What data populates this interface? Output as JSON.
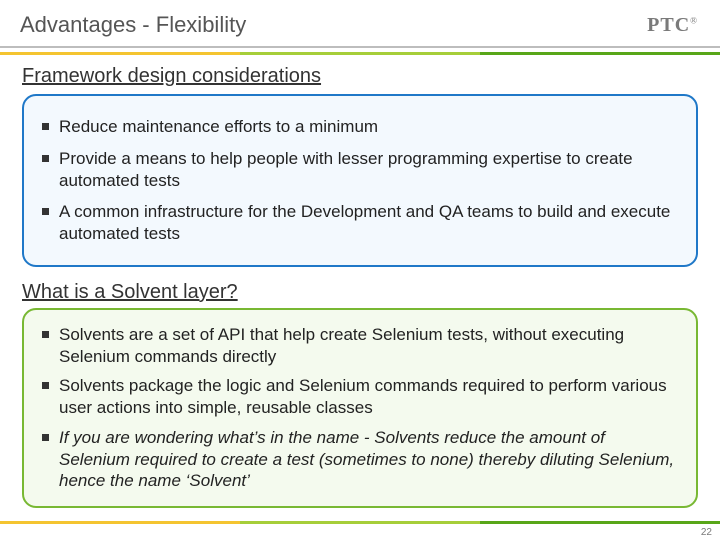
{
  "header": {
    "title": "Advantages - Flexibility",
    "brand": "PTC"
  },
  "section1": {
    "heading": "Framework design considerations",
    "bullets": [
      "Reduce maintenance efforts to a minimum",
      "Provide a means to help people with lesser programming expertise to create automated tests",
      "A common infrastructure for the Development and QA teams to build and execute automated tests"
    ]
  },
  "section2": {
    "heading": "What is a Solvent layer?",
    "bullets": [
      {
        "text": "Solvents are a set of API that help create Selenium tests, without executing Selenium commands directly",
        "italic": false
      },
      {
        "text": "Solvents package the logic and Selenium commands required to perform various user actions into simple, reusable classes",
        "italic": false
      },
      {
        "text": "If you are wondering what’s in the name - Solvents reduce the amount of Selenium required to create a test (sometimes to none) thereby diluting Selenium, hence the name ‘Solvent’",
        "italic": true
      }
    ]
  },
  "page": "22"
}
